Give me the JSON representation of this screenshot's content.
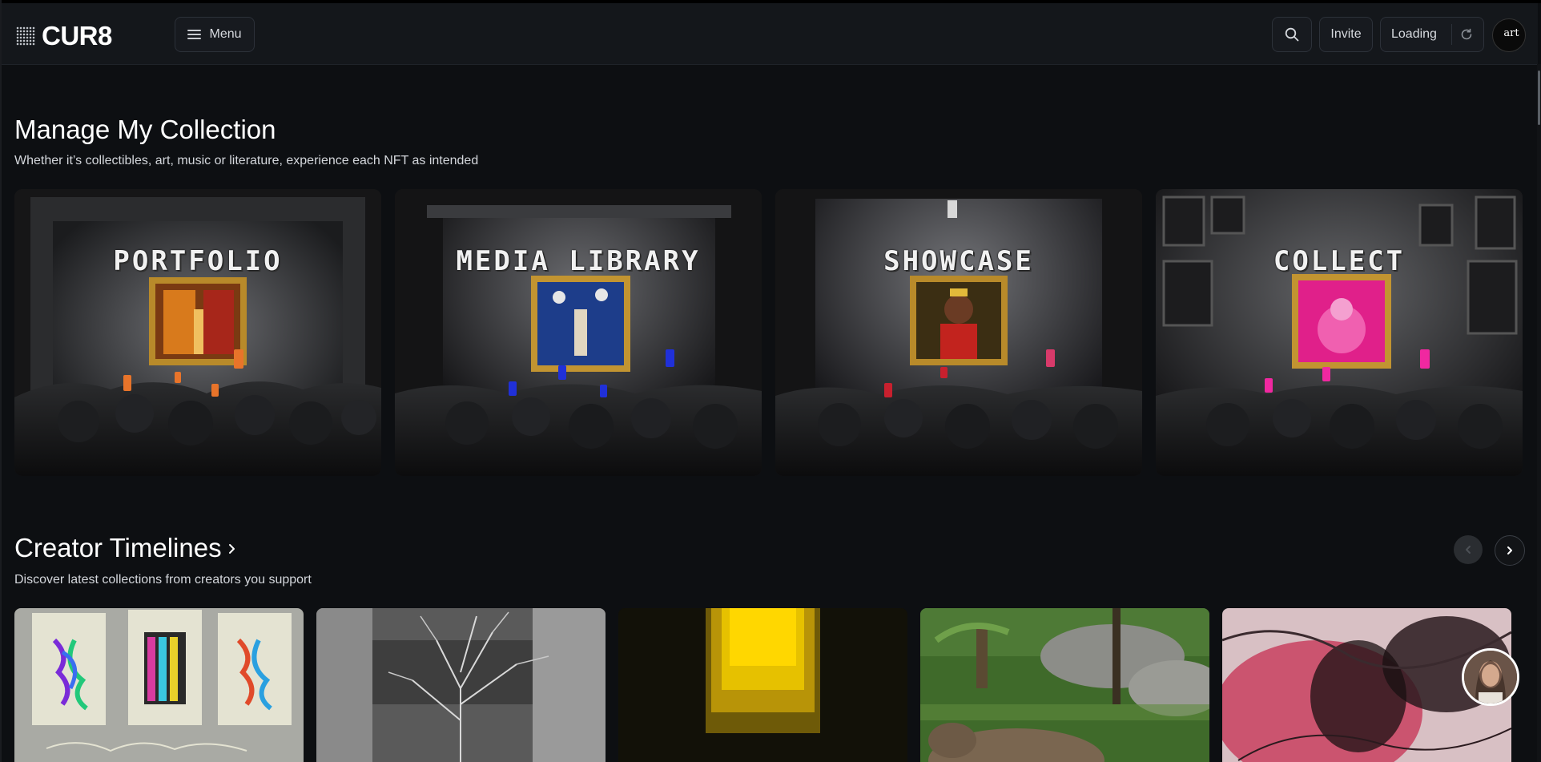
{
  "app": {
    "logo_text": "CUR8"
  },
  "header": {
    "menu_label": "Menu",
    "invite_label": "Invite",
    "loading_label": "Loading",
    "avatar_text": "art"
  },
  "collection": {
    "title": "Manage My Collection",
    "subtitle": "Whether it’s collectibles, art, music or literature, experience each NFT as intended",
    "tiles": [
      {
        "label": "PORTFOLIO"
      },
      {
        "label": "MEDIA LIBRARY"
      },
      {
        "label": "SHOWCASE"
      },
      {
        "label": "COLLECT"
      }
    ]
  },
  "timelines": {
    "title": "Creator Timelines",
    "subtitle": "Discover latest collections from creators you support"
  },
  "colors": {
    "background": "#0d0f12",
    "header": "#14171b",
    "border": "#2c3139"
  }
}
